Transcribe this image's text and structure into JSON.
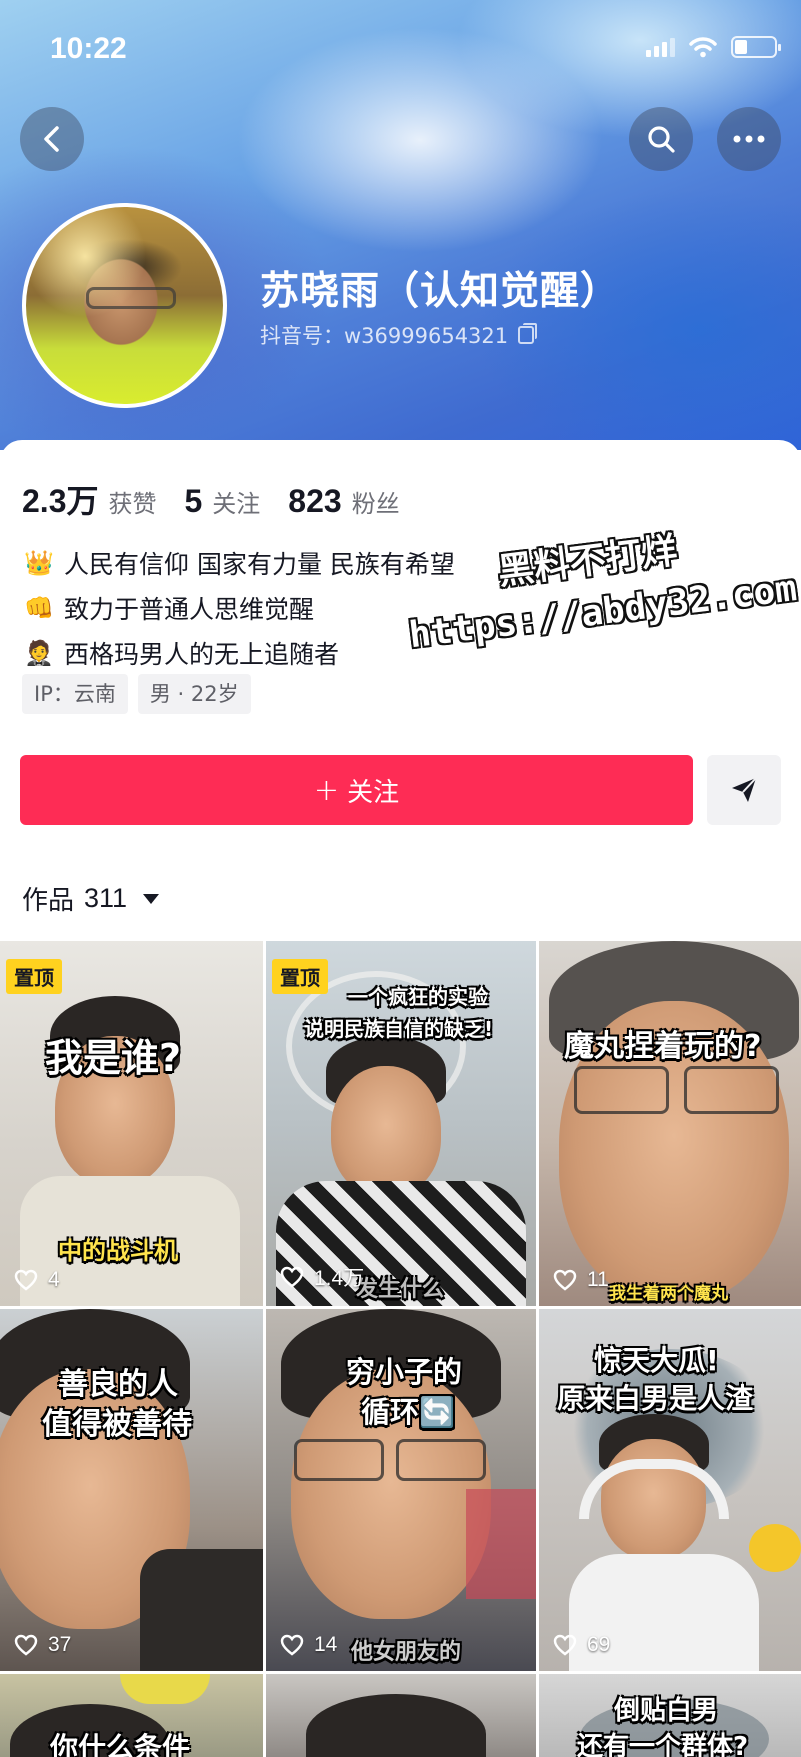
{
  "status_bar": {
    "time": "10:22"
  },
  "profile": {
    "name": "苏晓雨（认知觉醒）",
    "douyin_id": "抖音号：w36999654321",
    "stats": [
      {
        "value": "2.3万",
        "label": "获赞"
      },
      {
        "value": "5",
        "label": "关注"
      },
      {
        "value": "823",
        "label": "粉丝"
      }
    ],
    "bio": [
      {
        "emoji": "👑",
        "text": "人民有信仰 国家有力量 民族有希望"
      },
      {
        "emoji": "👊",
        "text": "致力于普通人思维觉醒"
      },
      {
        "emoji": "🤵",
        "text": "西格玛男人的无上追随者"
      }
    ],
    "tags": [
      "IP：云南",
      "男 · 22岁"
    ]
  },
  "watermark": {
    "line1": "黑料不打烊",
    "line2": "https://abdy32.com"
  },
  "actions": {
    "follow_icon": "+",
    "follow_label": "关注"
  },
  "works": {
    "label": "作品",
    "count": "311"
  },
  "videos": [
    {
      "pinned": "置顶",
      "caption": "我是谁?",
      "subcaption": "中的战斗机",
      "likes": "4"
    },
    {
      "pinned": "置顶",
      "caption": "一个疯狂的实验",
      "caption2": "说明民族自信的缺乏!",
      "subcaption": "发生什么",
      "likes": "1.4万"
    },
    {
      "caption": "魔丸捏着玩的?",
      "subcaption": "我生着两个魔丸",
      "likes": "11"
    },
    {
      "caption": "善良的人",
      "caption2": "值得被善待",
      "likes": "37"
    },
    {
      "caption": "穷小子的",
      "caption2": "循环🔄",
      "subcaption": "他女朋友的",
      "likes": "14"
    },
    {
      "caption": "惊天大瓜!",
      "caption2": "原来白男是人渣",
      "likes": "69"
    },
    {
      "caption": "你什么条件"
    },
    {
      "caption": ""
    },
    {
      "caption": "倒贴白男",
      "caption2": "还有一个群体?"
    }
  ],
  "colors": {
    "accent": "#fe2c55",
    "pin": "#ffd21f"
  },
  "icons": [
    "back-arrow-icon",
    "search-icon",
    "more-icon",
    "copy-icon",
    "share-icon",
    "heart-icon",
    "dropdown-caret-icon"
  ]
}
